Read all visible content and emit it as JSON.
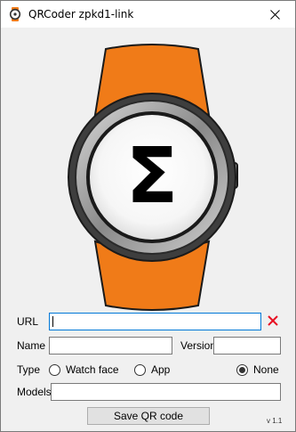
{
  "window": {
    "title": "QRCoder zpkd1-link"
  },
  "watch": {
    "glyph": "Σ",
    "strap_color": "#f07b18"
  },
  "form": {
    "url_label": "URL",
    "url_value": "",
    "name_label": "Name",
    "name_value": "",
    "version_label": "Version",
    "version_value": "",
    "type_label": "Type",
    "type_options": [
      "Watch face",
      "App",
      "None"
    ],
    "type_selected": "None",
    "models_label": "Models",
    "models_value": ""
  },
  "save_button": "Save QR code",
  "app_version": "v 1.1",
  "colors": {
    "accent": "#0078d7",
    "clear": "#e81123"
  }
}
